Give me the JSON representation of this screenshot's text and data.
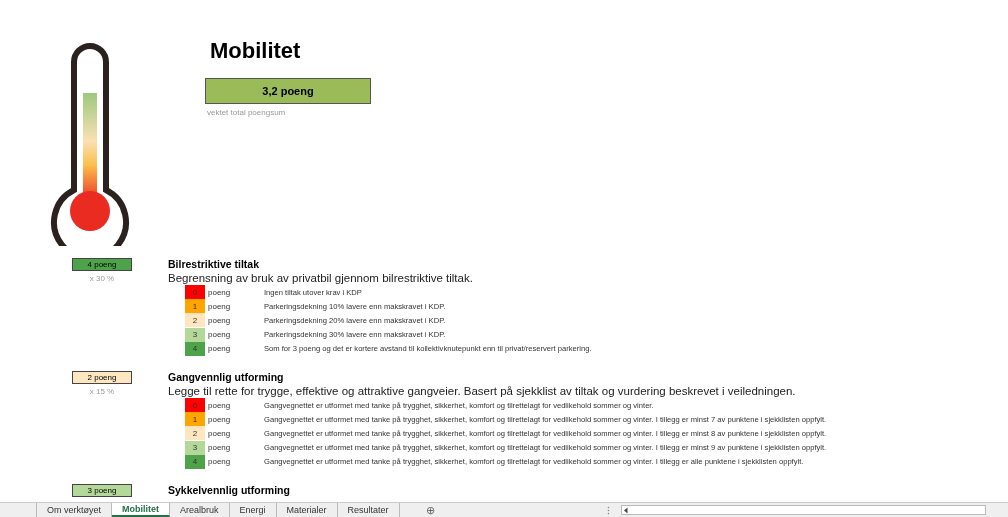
{
  "header": {
    "title": "Mobilitet",
    "total_score": "3,2 poeng",
    "total_caption": "vektet total poengsum"
  },
  "sections": [
    {
      "score": "4 poeng",
      "color": "#4ea24a",
      "weight": "x 30 %",
      "title": "Bilrestriktive tiltak",
      "description": "Begrensning av bruk av privatbil gjennom bilrestriktive tiltak.",
      "levels": [
        {
          "value": "0",
          "unit": "poeng",
          "color": "#ff0000",
          "text": "Ingen tiltak utover krav i KDP"
        },
        {
          "value": "1",
          "unit": "poeng",
          "color": "#ffa500",
          "text": "Parkeringsdekning 10% lavere enn makskravet i KDP."
        },
        {
          "value": "2",
          "unit": "poeng",
          "color": "#fde6c0",
          "text": "Parkeringsdekning 20% lavere enn makskravet i KDP."
        },
        {
          "value": "3",
          "unit": "poeng",
          "color": "#b4d89a",
          "text": "Parkeringsdekning 30% lavere enn makskravet i KDP."
        },
        {
          "value": "4",
          "unit": "poeng",
          "color": "#4ea24a",
          "text": "Som for 3 poeng og det er kortere avstand til kollektivknutepunkt enn til privat/reservert parkering."
        }
      ]
    },
    {
      "score": "2 poeng",
      "color": "#fde6c0",
      "weight": "x 15 %",
      "title": "Gangvennlig utforming",
      "description": "Legge til rette for trygge, effektive og attraktive gangveier. Basert på sjekklist av tiltak og vurdering beskrevet i veiledningen.",
      "levels": [
        {
          "value": "0",
          "unit": "poeng",
          "color": "#ff0000",
          "text": "Gangvegnettet er utformet med tanke på trygghet, sikkerhet, komfort og tilrettelagt for vedlikehold sommer og vinter."
        },
        {
          "value": "1",
          "unit": "poeng",
          "color": "#ffa500",
          "text": "Gangvegnettet er utformet med tanke på trygghet, sikkerhet, komfort og tilrettelagt for vedlikehold sommer og vinter. I tillegg er minst 7 av punktene i sjekklisten oppfylt."
        },
        {
          "value": "2",
          "unit": "poeng",
          "color": "#fde6c0",
          "text": "Gangvegnettet er utformet med tanke på trygghet, sikkerhet, komfort og tilrettelagt for vedlikehold sommer og vinter. I tillegg er minst 8 av punktene i sjekklisten oppfylt."
        },
        {
          "value": "3",
          "unit": "poeng",
          "color": "#b4d89a",
          "text": "Gangvegnettet er utformet med tanke på trygghet, sikkerhet, komfort og tilrettelagt for vedlikehold sommer og vinter. I tillegg er minst 9 av punktene i sjekklisten oppfylt."
        },
        {
          "value": "4",
          "unit": "poeng",
          "color": "#4ea24a",
          "text": "Gangvegnettet er utformet med tanke på trygghet, sikkerhet, komfort og tilrettelagt for vedlikehold sommer og vinter. I tillegg er alle punktene i sjekklisten oppfylt."
        }
      ]
    },
    {
      "score": "3 poeng",
      "color": "#b4d89a",
      "title": "Sykkelvennlig utforming"
    }
  ],
  "sheet_tabs": [
    {
      "label": "Om verktøyet",
      "selected": false
    },
    {
      "label": "Mobilitet",
      "selected": true
    },
    {
      "label": "Arealbruk",
      "selected": false
    },
    {
      "label": "Energi",
      "selected": false
    },
    {
      "label": "Materialer",
      "selected": false
    },
    {
      "label": "Resultater",
      "selected": false
    }
  ],
  "add_sheet": "⊕"
}
